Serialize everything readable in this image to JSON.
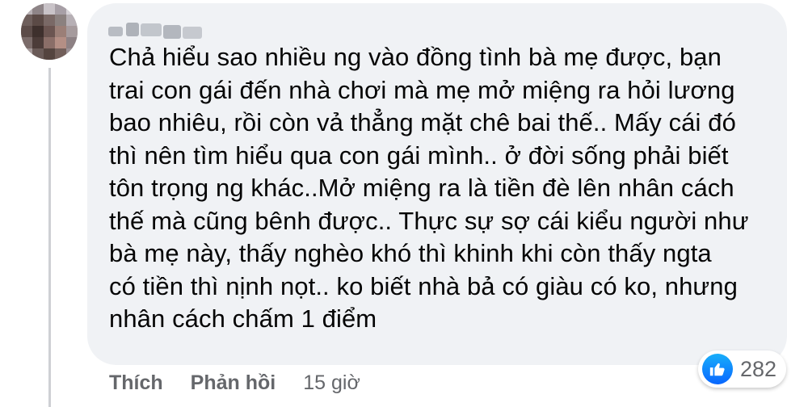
{
  "comment": {
    "author": {
      "name": "",
      "avatar": "pixelated-avatar"
    },
    "text": "Chả hiểu sao nhiều ng vào đồng tình bà mẹ được, bạn\ntrai con gái đến nhà chơi mà mẹ mở miệng ra hỏi lương\nbao nhiêu, rồi còn vả thẳng mặt chê bai thế.. Mấy cái đó\nthì nên tìm hiểu qua con gái mình.. ở đời sống phải biết\ntôn trọng ng khác..Mở miệng ra là tiền đè lên nhân cách\nthế mà cũng bênh được.. Thực sự sợ cái kiểu người như\nbà mẹ này, thấy nghèo khó thì khinh khi còn thấy ngta\ncó tiền thì nịnh nọt.. ko biết nhà bả có giàu có ko, nhưng\nnhân cách chấm 1 điểm",
    "reactions": {
      "icon": "like-icon",
      "count": "282"
    },
    "actions": {
      "like_label": "Thích",
      "reply_label": "Phản hồi",
      "time": "15 giờ"
    }
  },
  "colors": {
    "bubble_background": "#f0f2f5",
    "text_primary": "#050505",
    "text_secondary": "#65676b",
    "like_blue": "#0866ff",
    "thread_line": "#ced0d4"
  }
}
